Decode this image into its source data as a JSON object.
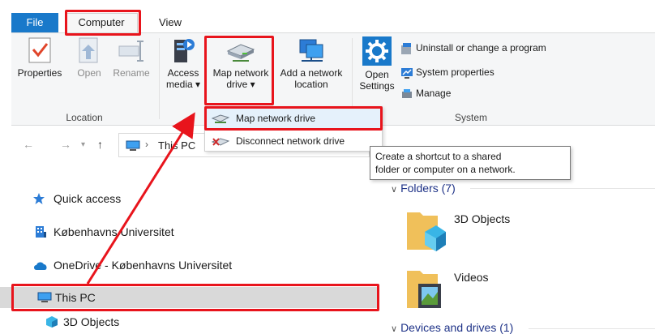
{
  "tabs": {
    "file": "File",
    "computer": "Computer",
    "view": "View"
  },
  "ribbon": {
    "location_group": {
      "label": "Location",
      "properties": "Properties",
      "open": "Open",
      "rename": "Rename"
    },
    "network_group": {
      "access_media_line1": "Access",
      "access_media_line2": "media ▾",
      "map_drive_line1": "Map network",
      "map_drive_line2": "drive ▾",
      "add_location_line1": "Add a network",
      "add_location_line2": "location"
    },
    "system_group": {
      "label": "System",
      "open_settings_line1": "Open",
      "open_settings_line2": "Settings",
      "uninstall": "Uninstall or change a program",
      "system_properties": "System properties",
      "manage": "Manage"
    }
  },
  "dropdown": {
    "items": [
      {
        "label": "Map network drive"
      },
      {
        "label": "Disconnect network drive"
      }
    ]
  },
  "tooltip": {
    "line1": "Create a shortcut to a shared",
    "line2": "folder or computer on a network."
  },
  "address": {
    "path": "This PC"
  },
  "nav_pane": {
    "items": [
      {
        "label": "Quick access"
      },
      {
        "label": "Københavns Universitet"
      },
      {
        "label": "OneDrive - Københavns Universitet"
      },
      {
        "label": "This PC"
      },
      {
        "label": "3D Objects"
      }
    ]
  },
  "content": {
    "folders_header": "Folders (7)",
    "folders": [
      {
        "label": "3D Objects"
      },
      {
        "label": "Videos"
      }
    ],
    "devices_header": "Devices and drives (1)"
  },
  "colors": {
    "accent": "#1979ca",
    "highlight": "#e8141c",
    "selected_row": "#d9d9d9"
  }
}
